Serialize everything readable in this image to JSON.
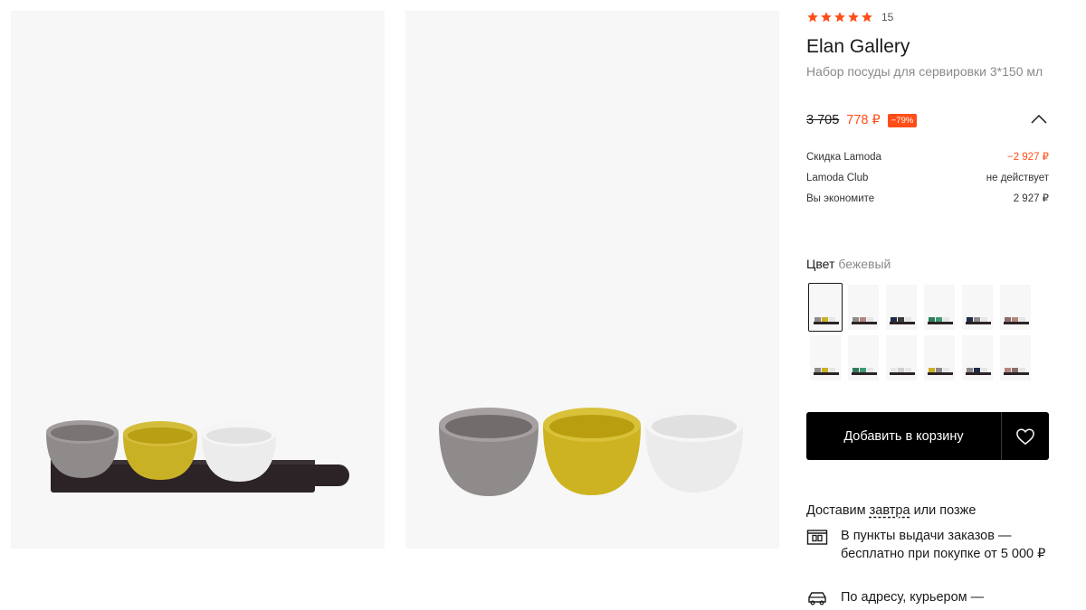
{
  "gallery": {
    "photo_1_alt": "product-photo-on-board",
    "photo_2_alt": "product-photo-bowls"
  },
  "product": {
    "rating_count": "15",
    "brand": "Elan Gallery",
    "name": "Набор посуды для сервировки 3*150 мл",
    "old_price": "3 705",
    "new_price": "778 ₽",
    "discount": "−79%"
  },
  "breakdown": [
    {
      "label": "Скидка Lamoda",
      "value": "−2 927 ₽"
    },
    {
      "label": "Lamoda Club",
      "value": "не действует"
    },
    {
      "label": "Вы экономите",
      "value": "2 927 ₽"
    }
  ],
  "color": {
    "label": "Цвет",
    "value": "бежевый"
  },
  "cart": {
    "add_label": "Добавить в корзину"
  },
  "delivery": {
    "title_prefix": "Доставим",
    "title_link": "завтра",
    "title_suffix": "или позже",
    "pickup": "В пункты выдачи заказов — бесплатно при покупке от 5 000 ₽",
    "courier": "По адресу, курьером —"
  },
  "colors": {
    "accent": "#ff4e18",
    "button": "#000000",
    "star": "#ff4e18"
  }
}
